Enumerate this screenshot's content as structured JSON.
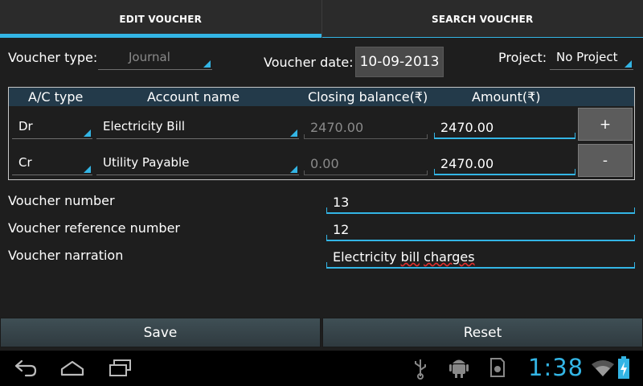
{
  "tabs": [
    {
      "label": "EDIT VOUCHER",
      "active": true
    },
    {
      "label": "SEARCH VOUCHER",
      "active": false
    }
  ],
  "header": {
    "voucher_type_label": "Voucher type:",
    "voucher_type_value": "Journal",
    "voucher_date_label": "Voucher date:",
    "voucher_date_value": "10-09-2013",
    "project_label": "Project:",
    "project_value": "No Project"
  },
  "table": {
    "columns": [
      "A/C type",
      "Account name",
      "Closing balance(₹)",
      "Amount(₹)"
    ],
    "rows": [
      {
        "ac_type": "Dr",
        "account_name": "Electricity Bill",
        "closing_balance": "2470.00",
        "amount": "2470.00",
        "button": "+"
      },
      {
        "ac_type": "Cr",
        "account_name": "Utility Payable",
        "closing_balance": "0.00",
        "amount": "2470.00",
        "button": "-"
      }
    ]
  },
  "form": {
    "voucher_number_label": "Voucher number",
    "voucher_number_value": "13",
    "reference_label": "Voucher reference number",
    "reference_value": "12",
    "narration_label": "Voucher narration",
    "narration_word1": "Electricity",
    "narration_word2": "bill",
    "narration_word3": "charges"
  },
  "actions": {
    "save_label": "Save",
    "reset_label": "Reset"
  },
  "statusbar": {
    "time": "1:38",
    "icons": [
      "back-icon",
      "home-icon",
      "recent-apps-icon",
      "usb-icon",
      "android-debug-icon",
      "sd-card-icon",
      "wifi-icon",
      "battery-charging-icon"
    ]
  },
  "colors": {
    "accent": "#33b5e5",
    "background": "#1e1e1e",
    "spell_error": "#e03030"
  }
}
